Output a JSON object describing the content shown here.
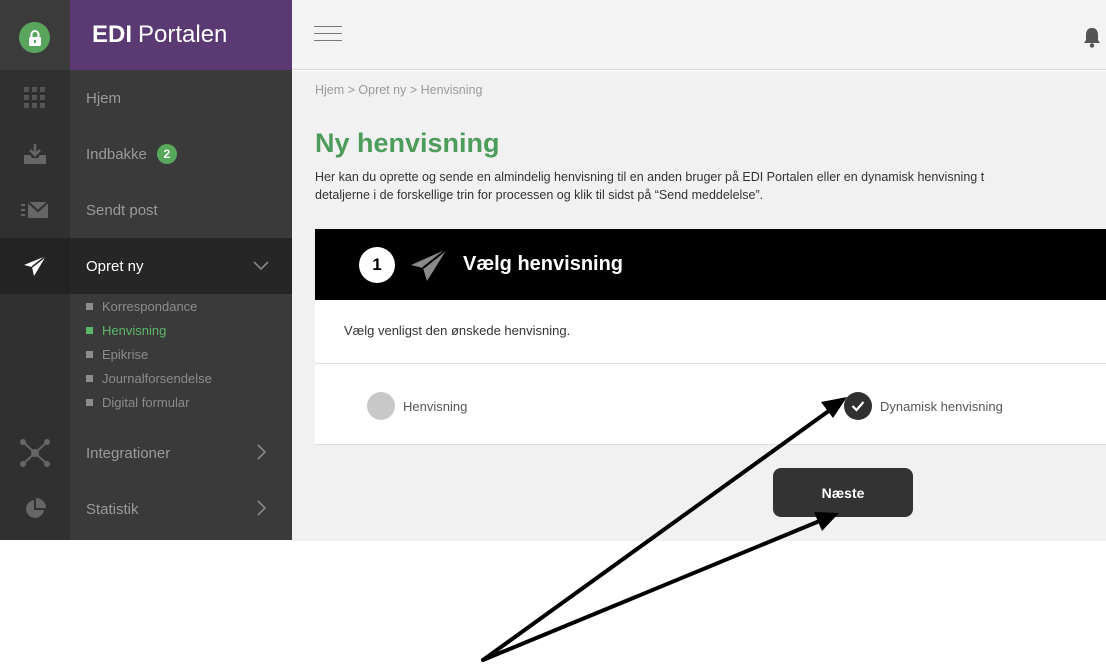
{
  "brand": {
    "bold": "EDI",
    "rest": "Portalen"
  },
  "sidebar": {
    "items": [
      {
        "label": "Hjem",
        "icon": "grid-icon"
      },
      {
        "label": "Indbakke",
        "badge": "2",
        "icon": "inbox-download-icon"
      },
      {
        "label": "Sendt post",
        "icon": "sent-mail-icon"
      },
      {
        "label": "Opret ny",
        "icon": "paper-plane-icon"
      },
      {
        "label": "Integrationer",
        "icon": "network-icon"
      },
      {
        "label": "Statistik",
        "icon": "pie-chart-icon"
      }
    ],
    "subitems": [
      {
        "label": "Korrespondance"
      },
      {
        "label": "Henvisning"
      },
      {
        "label": "Epikrise"
      },
      {
        "label": "Journalforsendelse"
      },
      {
        "label": "Digital formular"
      }
    ]
  },
  "breadcrumb": "Hjem  >  Opret ny  >  Henvisning",
  "page": {
    "title": "Ny henvisning",
    "intro_line1": "Her kan du oprette og sende en almindelig henvisning til en anden bruger på EDI Portalen eller en dynamisk henvisning t",
    "intro_line2": "detaljerne i de forskellige trin for processen og klik til sidst på “Send meddelelse”."
  },
  "step": {
    "number": "1",
    "title": "Vælg henvisning",
    "description": "Vælg venligst den ønskede henvisning.",
    "options": [
      {
        "label": "Henvisning",
        "checked": false
      },
      {
        "label": "Dynamisk henvisning",
        "checked": true
      }
    ],
    "next_label": "Næste"
  },
  "colors": {
    "brand_purple": "#5b3a74",
    "accent_green": "#4e9c5b",
    "sidebar_dark": "#3a3a3a"
  }
}
